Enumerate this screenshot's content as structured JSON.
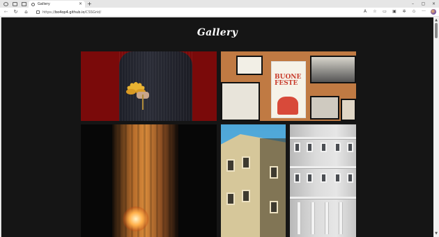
{
  "browser": {
    "tab": {
      "title": "Gallery",
      "close_glyph": "×"
    },
    "new_tab_glyph": "+",
    "window_controls": {
      "minimize": "–",
      "maximize": "▢",
      "close": "×"
    },
    "nav": {
      "back": "←",
      "refresh": "↻",
      "home": "⌂"
    },
    "address": {
      "scheme": "https://",
      "host": "bo4op4.github.io",
      "path": "/CSSGrid/"
    },
    "toolbar_icons": [
      "read-aloud-icon",
      "favorite-icon",
      "split-screen-icon",
      "collections-icon",
      "extensions-icon",
      "favorites-bar-icon",
      "menu-icon",
      "profile-icon"
    ]
  },
  "page": {
    "title": "Gallery",
    "background": "#151515",
    "tiles": [
      {
        "subject": "flowers-held-behind-back"
      },
      {
        "subject": "poster-wall-buone-feste"
      },
      {
        "subject": "backlit-curtain"
      },
      {
        "subject": "yellow-building"
      },
      {
        "subject": "white-building"
      }
    ],
    "poster_text": "BUONE FESTE"
  }
}
